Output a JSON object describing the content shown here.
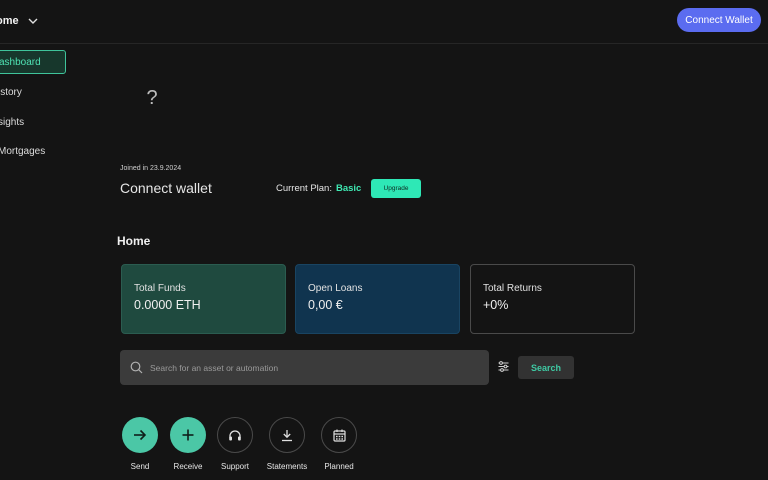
{
  "header": {
    "workspace_label": "ome",
    "connect_label": "Connect Wallet"
  },
  "sidebar": {
    "items": [
      {
        "label": "ashboard",
        "active": true
      },
      {
        "label": "istory"
      },
      {
        "label": "sights"
      },
      {
        "label": "Mortgages"
      }
    ]
  },
  "profile": {
    "avatar_placeholder": "?",
    "joined": "Joined in 23.9.2024",
    "name": "Connect wallet",
    "plan_label": "Current Plan:",
    "plan_value": "Basic",
    "upgrade_label": "Upgrade"
  },
  "home": {
    "title": "Home",
    "cards": [
      {
        "label": "Total Funds",
        "value": "0.0000 ETH"
      },
      {
        "label": "Open Loans",
        "value": "0,00 €"
      },
      {
        "label": "Total Returns",
        "value": "+0%"
      }
    ]
  },
  "search": {
    "placeholder": "Search for an asset or automation",
    "button_label": "Search"
  },
  "actions": [
    {
      "label": "Send",
      "icon": "arrow-right-icon"
    },
    {
      "label": "Receive",
      "icon": "plus-icon"
    },
    {
      "label": "Support",
      "icon": "headset-icon"
    },
    {
      "label": "Statements",
      "icon": "download-icon"
    },
    {
      "label": "Planned",
      "icon": "calendar-icon"
    }
  ],
  "colors": {
    "accent": "#4bc7a6",
    "primary_button": "#5b6cf0",
    "background": "#141414"
  }
}
